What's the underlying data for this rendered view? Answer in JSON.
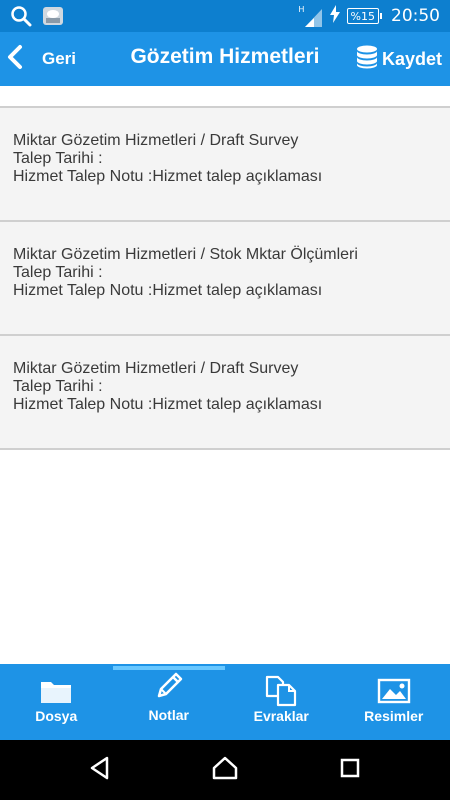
{
  "status_bar": {
    "time": "20:50",
    "battery": "%15",
    "network_type": "H",
    "icons": [
      "search-icon",
      "notification-app-icon",
      "signal-icon",
      "charging-icon",
      "battery-icon"
    ]
  },
  "app_bar": {
    "back_label": "Geri",
    "title": "Gözetim Hizmetleri",
    "save_label": "Kaydet",
    "background": "#1e93e6"
  },
  "list": {
    "items": [
      {
        "service": "Miktar Gözetim Hizmetleri / Draft Survey",
        "date": "Talep Tarihi :",
        "note": "Hizmet Talep Notu :Hizmet talep açıklaması"
      },
      {
        "service": "Miktar Gözetim Hizmetleri / Stok Mktar Ölçümleri",
        "date": "Talep Tarihi :",
        "note": "Hizmet Talep Notu :Hizmet talep açıklaması"
      },
      {
        "service": "Miktar Gözetim Hizmetleri / Draft Survey",
        "date": "Talep Tarihi :",
        "note": "Hizmet Talep Notu :Hizmet talep açıklaması"
      }
    ]
  },
  "tabs": {
    "items": [
      {
        "label": "Dosya",
        "icon": "folder-icon"
      },
      {
        "label": "Notlar",
        "icon": "pencil-icon"
      },
      {
        "label": "Evraklar",
        "icon": "documents-icon"
      },
      {
        "label": "Resimler",
        "icon": "image-icon"
      }
    ],
    "active_index": 1,
    "indicator_color": "#68c7ff"
  },
  "nav_bar": {
    "buttons": [
      "back-triangle-icon",
      "home-icon",
      "recents-icon"
    ]
  }
}
